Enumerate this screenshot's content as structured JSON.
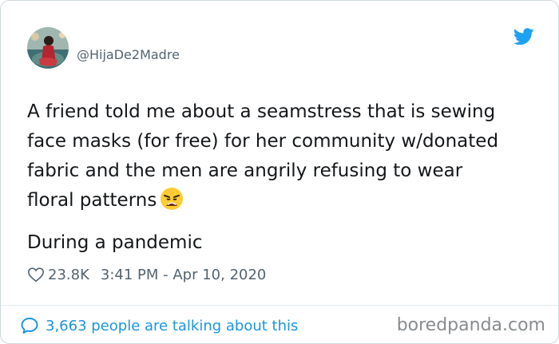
{
  "author": {
    "handle": "@HijaDe2Madre",
    "avatar_icon": "user-avatar-photo"
  },
  "brand": {
    "icon": "twitter-bird-icon",
    "color": "#1da1f2"
  },
  "tweet": {
    "lines": [
      "A friend told me about a seamstress that is sewing",
      "face masks (for free) for her community w/donated",
      "fabric and the men are angrily refusing to wear",
      "floral patterns"
    ],
    "emoji": "weary-face-emoji",
    "second_paragraph": "During a pandemic"
  },
  "meta": {
    "likes": "23.8K",
    "timestamp": "3:41 PM - Apr 10, 2020"
  },
  "footer": {
    "talking": "3,663 people are talking about this",
    "link_color": "#1b95e0"
  },
  "watermark": "boredpanda.com"
}
